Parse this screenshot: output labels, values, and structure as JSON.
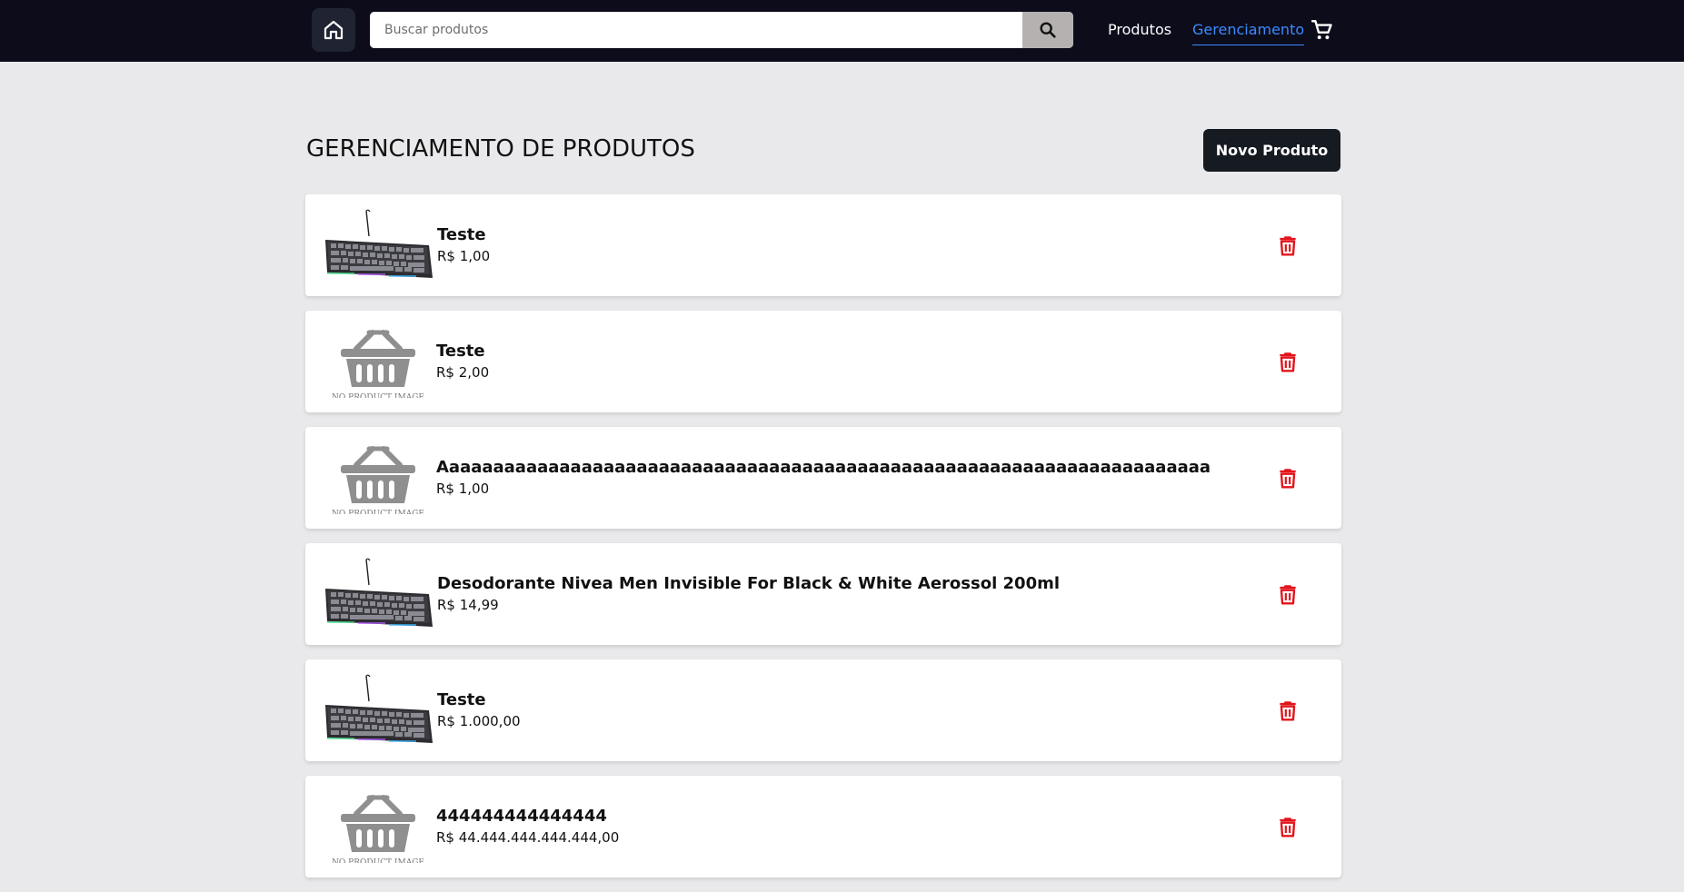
{
  "header": {
    "search": {
      "placeholder": "Buscar produtos",
      "value": ""
    },
    "nav": {
      "produtos": "Produtos",
      "gerenciamento": "Gerenciamento"
    },
    "icons": {
      "home": "home-icon",
      "search": "search-icon",
      "cart": "cart-icon"
    },
    "colors": {
      "background": "#0c0c1b",
      "active_link": "#3b8bff"
    }
  },
  "page": {
    "title": "GERENCIAMENTO DE PRODUTOS",
    "new_button_label": "Novo Produto"
  },
  "no_image_label": "NO PRODUCT IMAGE",
  "products": [
    {
      "name": "Teste",
      "price": "R$ 1,00",
      "image": "keyboard"
    },
    {
      "name": "Teste",
      "price": "R$ 2,00",
      "image": "no-image"
    },
    {
      "name": "Aaaaaaaaaaaaaaaaaaaaaaaaaaaaaaaaaaaaaaaaaaaaaaaaaaaaaaaaaaaaaaaaaaaaaaaaaaaaaaaaaaaaaaaa",
      "price": "R$ 1,00",
      "image": "no-image"
    },
    {
      "name": "Desodorante Nivea Men Invisible For Black & White Aerossol 200ml",
      "price": "R$ 14,99",
      "image": "keyboard"
    },
    {
      "name": "Teste",
      "price": "R$ 1.000,00",
      "image": "keyboard"
    },
    {
      "name": "444444444444444",
      "price": "R$ 44.444.444.444.444,00",
      "image": "no-image"
    }
  ],
  "delete_icon": "trash-icon",
  "delete_color": "#e3141c"
}
